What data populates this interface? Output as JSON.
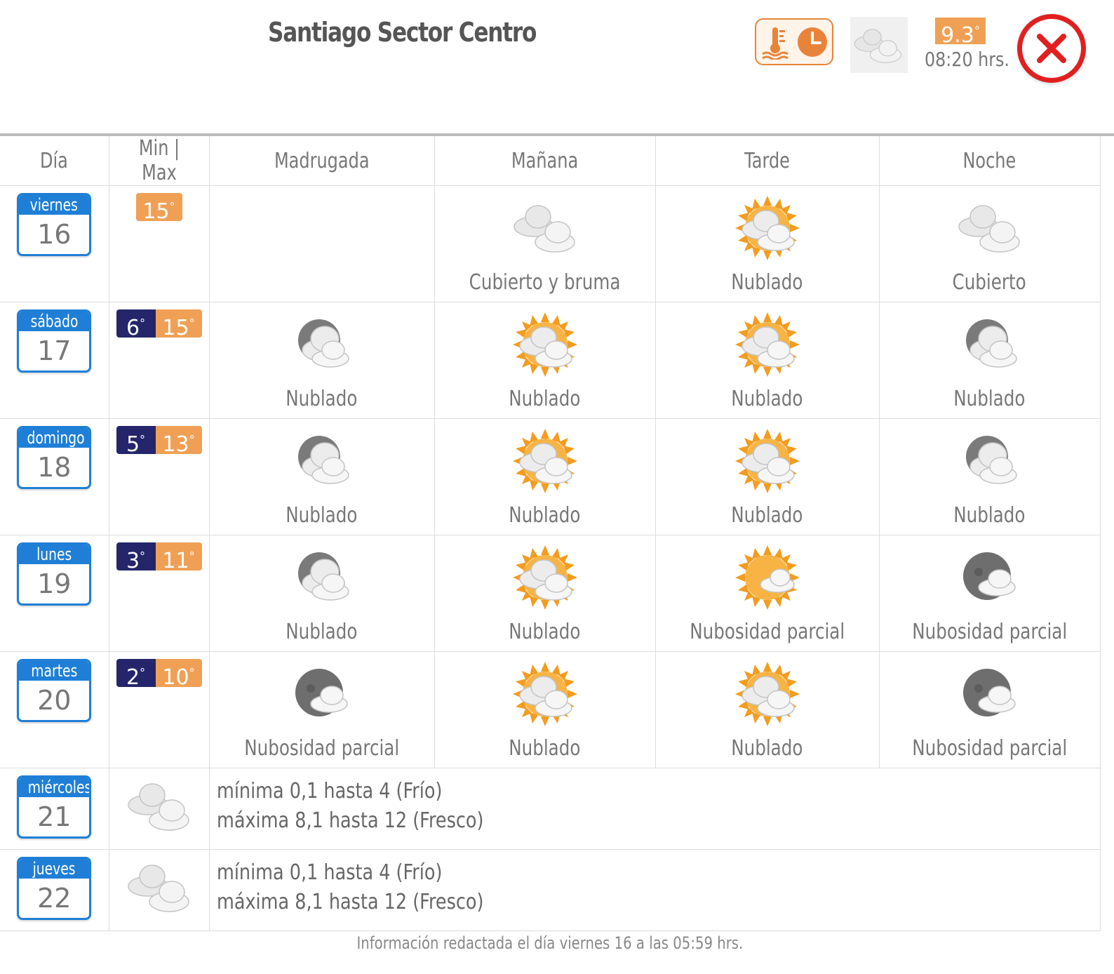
{
  "header": {
    "title": "Santiago Sector Centro",
    "current_temp": "9.3",
    "current_time": "08:20 hrs."
  },
  "table": {
    "headers": [
      "Día",
      "Min | Max",
      "Madrugada",
      "Mañana",
      "Tarde",
      "Noche"
    ],
    "days": [
      {
        "name": "viernes",
        "num": "16",
        "min": "",
        "max": "15",
        "periods": [
          {
            "icon": "empty",
            "label": ""
          },
          {
            "icon": "overcast-icon",
            "label": "Cubierto y bruma"
          },
          {
            "icon": "sun-cloud-icon",
            "label": "Nublado"
          },
          {
            "icon": "overcast-icon",
            "label": "Cubierto"
          }
        ]
      },
      {
        "name": "sábado",
        "num": "17",
        "min": "6",
        "max": "15",
        "periods": [
          {
            "icon": "moon-cloud-icon",
            "label": "Nublado"
          },
          {
            "icon": "sun-cloud-icon",
            "label": "Nublado"
          },
          {
            "icon": "sun-cloud-icon",
            "label": "Nublado"
          },
          {
            "icon": "moon-cloud-icon",
            "label": "Nublado"
          }
        ]
      },
      {
        "name": "domingo",
        "num": "18",
        "min": "5",
        "max": "13",
        "periods": [
          {
            "icon": "moon-cloud-icon",
            "label": "Nublado"
          },
          {
            "icon": "sun-cloud-icon",
            "label": "Nublado"
          },
          {
            "icon": "sun-cloud-icon",
            "label": "Nublado"
          },
          {
            "icon": "moon-cloud-icon",
            "label": "Nublado"
          }
        ]
      },
      {
        "name": "lunes",
        "num": "19",
        "min": "3",
        "max": "11",
        "periods": [
          {
            "icon": "moon-cloud-icon",
            "label": "Nublado"
          },
          {
            "icon": "sun-cloud-icon",
            "label": "Nublado"
          },
          {
            "icon": "sun-small-cloud-icon",
            "label": "Nubosidad parcial"
          },
          {
            "icon": "moon-small-cloud-icon",
            "label": "Nubosidad parcial"
          }
        ]
      },
      {
        "name": "martes",
        "num": "20",
        "min": "2",
        "max": "10",
        "periods": [
          {
            "icon": "moon-small-cloud-icon",
            "label": "Nubosidad parcial"
          },
          {
            "icon": "sun-cloud-icon",
            "label": "Nublado"
          },
          {
            "icon": "sun-cloud-icon",
            "label": "Nublado"
          },
          {
            "icon": "moon-small-cloud-icon",
            "label": "Nubosidad parcial"
          }
        ]
      }
    ],
    "extended": [
      {
        "name": "miércoles",
        "num": "21",
        "icon": "overcast-icon",
        "line1": "mínima 0,1 hasta 4 (Frío)",
        "line2": "máxima 8,1 hasta 12 (Fresco)"
      },
      {
        "name": "jueves",
        "num": "22",
        "icon": "overcast-icon",
        "line1": "mínima 0,1 hasta 4 (Frío)",
        "line2": "máxima 8,1 hasta 12 (Fresco)"
      }
    ]
  },
  "footer": {
    "text": "Información redactada el día viernes 16 a las 05:59 hrs."
  },
  "colors": {
    "calendar_blue": "#1f7fd6",
    "min_navy": "#25256b",
    "max_orange": "#f0a055",
    "close_red": "#e02020"
  }
}
